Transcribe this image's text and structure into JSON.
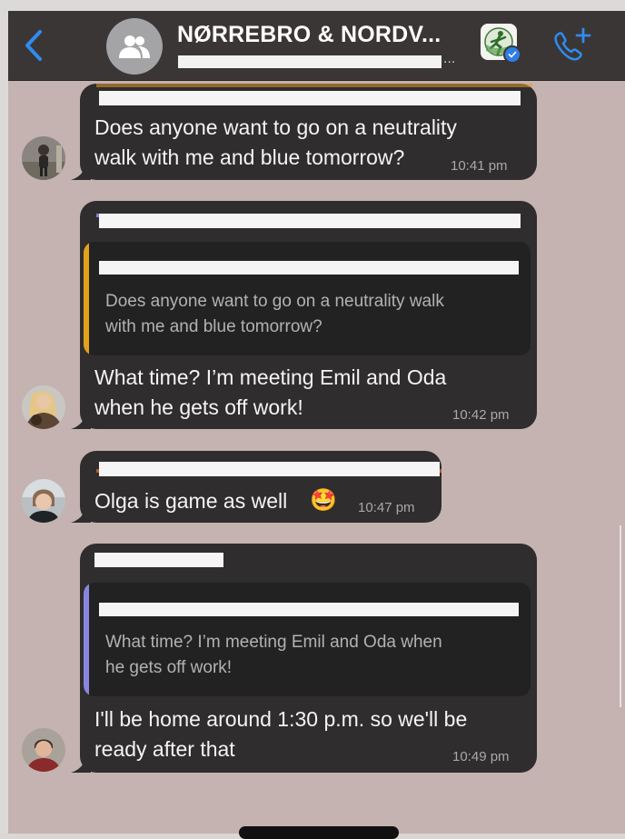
{
  "header": {
    "title": "NØRREBRO & NORDV...",
    "subtitle_ellipsis": "..."
  },
  "messages": [
    {
      "sender_redacted": true,
      "sender_color": "#e89a2c",
      "text_line1": "Does anyone want to go on a neutrality",
      "text_line2": "walk with me and blue tomorrow?",
      "time": "10:41 pm"
    },
    {
      "sender_redacted": true,
      "sender_color": "#7d7fe0",
      "quote_line1": "Does anyone want to go on a neutrality walk",
      "quote_line2": "with me and blue tomorrow?",
      "quote_bar_color": "#e3a21a",
      "text_line1": "What time? I’m meeting Emil and Oda",
      "text_line2": "when he gets off work!",
      "time": "10:42 pm"
    },
    {
      "sender_redacted": true,
      "sender_color": "#e8722c",
      "text_line1": "Olga is game as well",
      "emoji": "🤩",
      "time": "10:47 pm"
    },
    {
      "sender_redacted": true,
      "sender_color": "#e6d21c",
      "quote_line1": "What time? I’m meeting Emil and Oda when",
      "quote_line2": "he gets off work!",
      "quote_bar_color": "#8a86e0",
      "text_line1": "I'll be home around 1:30 p.m. so we'll be",
      "text_line2": "ready after that",
      "time": "10:49 pm"
    }
  ]
}
